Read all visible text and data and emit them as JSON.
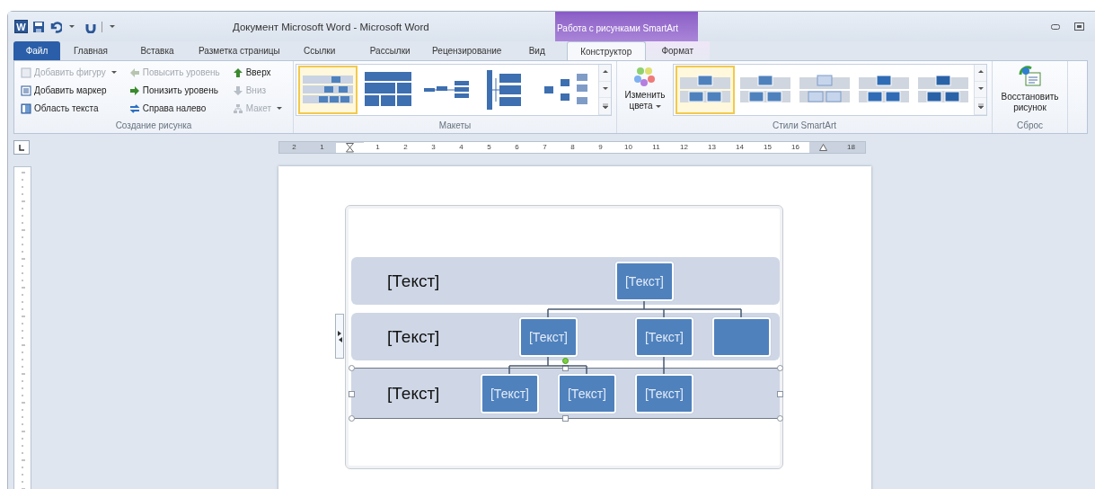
{
  "window": {
    "app_icon": "W",
    "title": "Документ Microsoft Word - Microsoft Word"
  },
  "contextual_group": {
    "label": "Работа с рисунками SmartArt"
  },
  "tabs": [
    {
      "label": "Файл",
      "kind": "file",
      "selected": false
    },
    {
      "label": "Главная",
      "kind": "normal",
      "selected": false
    },
    {
      "label": "Вставка",
      "kind": "normal",
      "selected": false
    },
    {
      "label": "Разметка страницы",
      "kind": "normal",
      "selected": false
    },
    {
      "label": "Ссылки",
      "kind": "normal",
      "selected": false
    },
    {
      "label": "Рассылки",
      "kind": "normal",
      "selected": false
    },
    {
      "label": "Рецензирование",
      "kind": "normal",
      "selected": false
    },
    {
      "label": "Вид",
      "kind": "normal",
      "selected": false
    },
    {
      "label": "Конструктор",
      "kind": "contextual",
      "selected": true
    },
    {
      "label": "Формат",
      "kind": "contextual",
      "selected": false
    }
  ],
  "ribbon": {
    "create_group": {
      "label": "Создание рисунка",
      "commands": [
        {
          "label": "Добавить фигуру",
          "disabled": true,
          "dropdown": true
        },
        {
          "label": "Повысить уровень",
          "disabled": true,
          "dropdown": false
        },
        {
          "label": "Вверх",
          "disabled": false,
          "dropdown": false
        },
        {
          "label": "Добавить маркер",
          "disabled": false,
          "dropdown": false
        },
        {
          "label": "Понизить уровень",
          "disabled": false,
          "dropdown": false
        },
        {
          "label": "Вниз",
          "disabled": true,
          "dropdown": false
        },
        {
          "label": "Область текста",
          "disabled": false,
          "dropdown": false
        },
        {
          "label": "Справа налево",
          "disabled": false,
          "dropdown": false
        },
        {
          "label": "Макет",
          "disabled": true,
          "dropdown": true
        }
      ]
    },
    "layouts_group": {
      "label": "Макеты",
      "items": [
        {
          "selected": true
        },
        {
          "selected": false
        },
        {
          "selected": false
        },
        {
          "selected": false
        },
        {
          "selected": false
        }
      ]
    },
    "styles_group": {
      "label": "Стили SmartArt",
      "change_colors": {
        "label": "Изменить цвета",
        "dropdown": true
      },
      "items": [
        {
          "selected": true
        },
        {
          "selected": false
        },
        {
          "selected": false
        },
        {
          "selected": false
        },
        {
          "selected": false
        }
      ]
    },
    "reset_group": {
      "label": "Сброс",
      "reset_button": {
        "label": "Восстановить рисунок"
      }
    }
  },
  "ruler": {
    "left_numbers": [
      "2",
      "1"
    ],
    "right_numbers": [
      "1",
      "2",
      "3",
      "4",
      "5",
      "6",
      "7",
      "8",
      "9",
      "10",
      "11",
      "12",
      "13",
      "14",
      "15",
      "16"
    ],
    "end_number": "18"
  },
  "smartart": {
    "bands": [
      {
        "label": "[Текст]",
        "selected": false
      },
      {
        "label": "[Текст]",
        "selected": false
      },
      {
        "label": "[Текст]",
        "selected": true
      }
    ],
    "nodes": [
      {
        "kind": "text",
        "text": "[Текст]",
        "children": [
          {
            "kind": "text",
            "text": "[Текст]",
            "children": [
              {
                "kind": "text",
                "text": "[Текст]"
              },
              {
                "kind": "text",
                "text": "[Текст]"
              }
            ]
          },
          {
            "kind": "text",
            "text": "[Текст]",
            "children": [
              {
                "kind": "text",
                "text": "[Текст]"
              }
            ]
          },
          {
            "kind": "blank"
          }
        ]
      }
    ]
  }
}
